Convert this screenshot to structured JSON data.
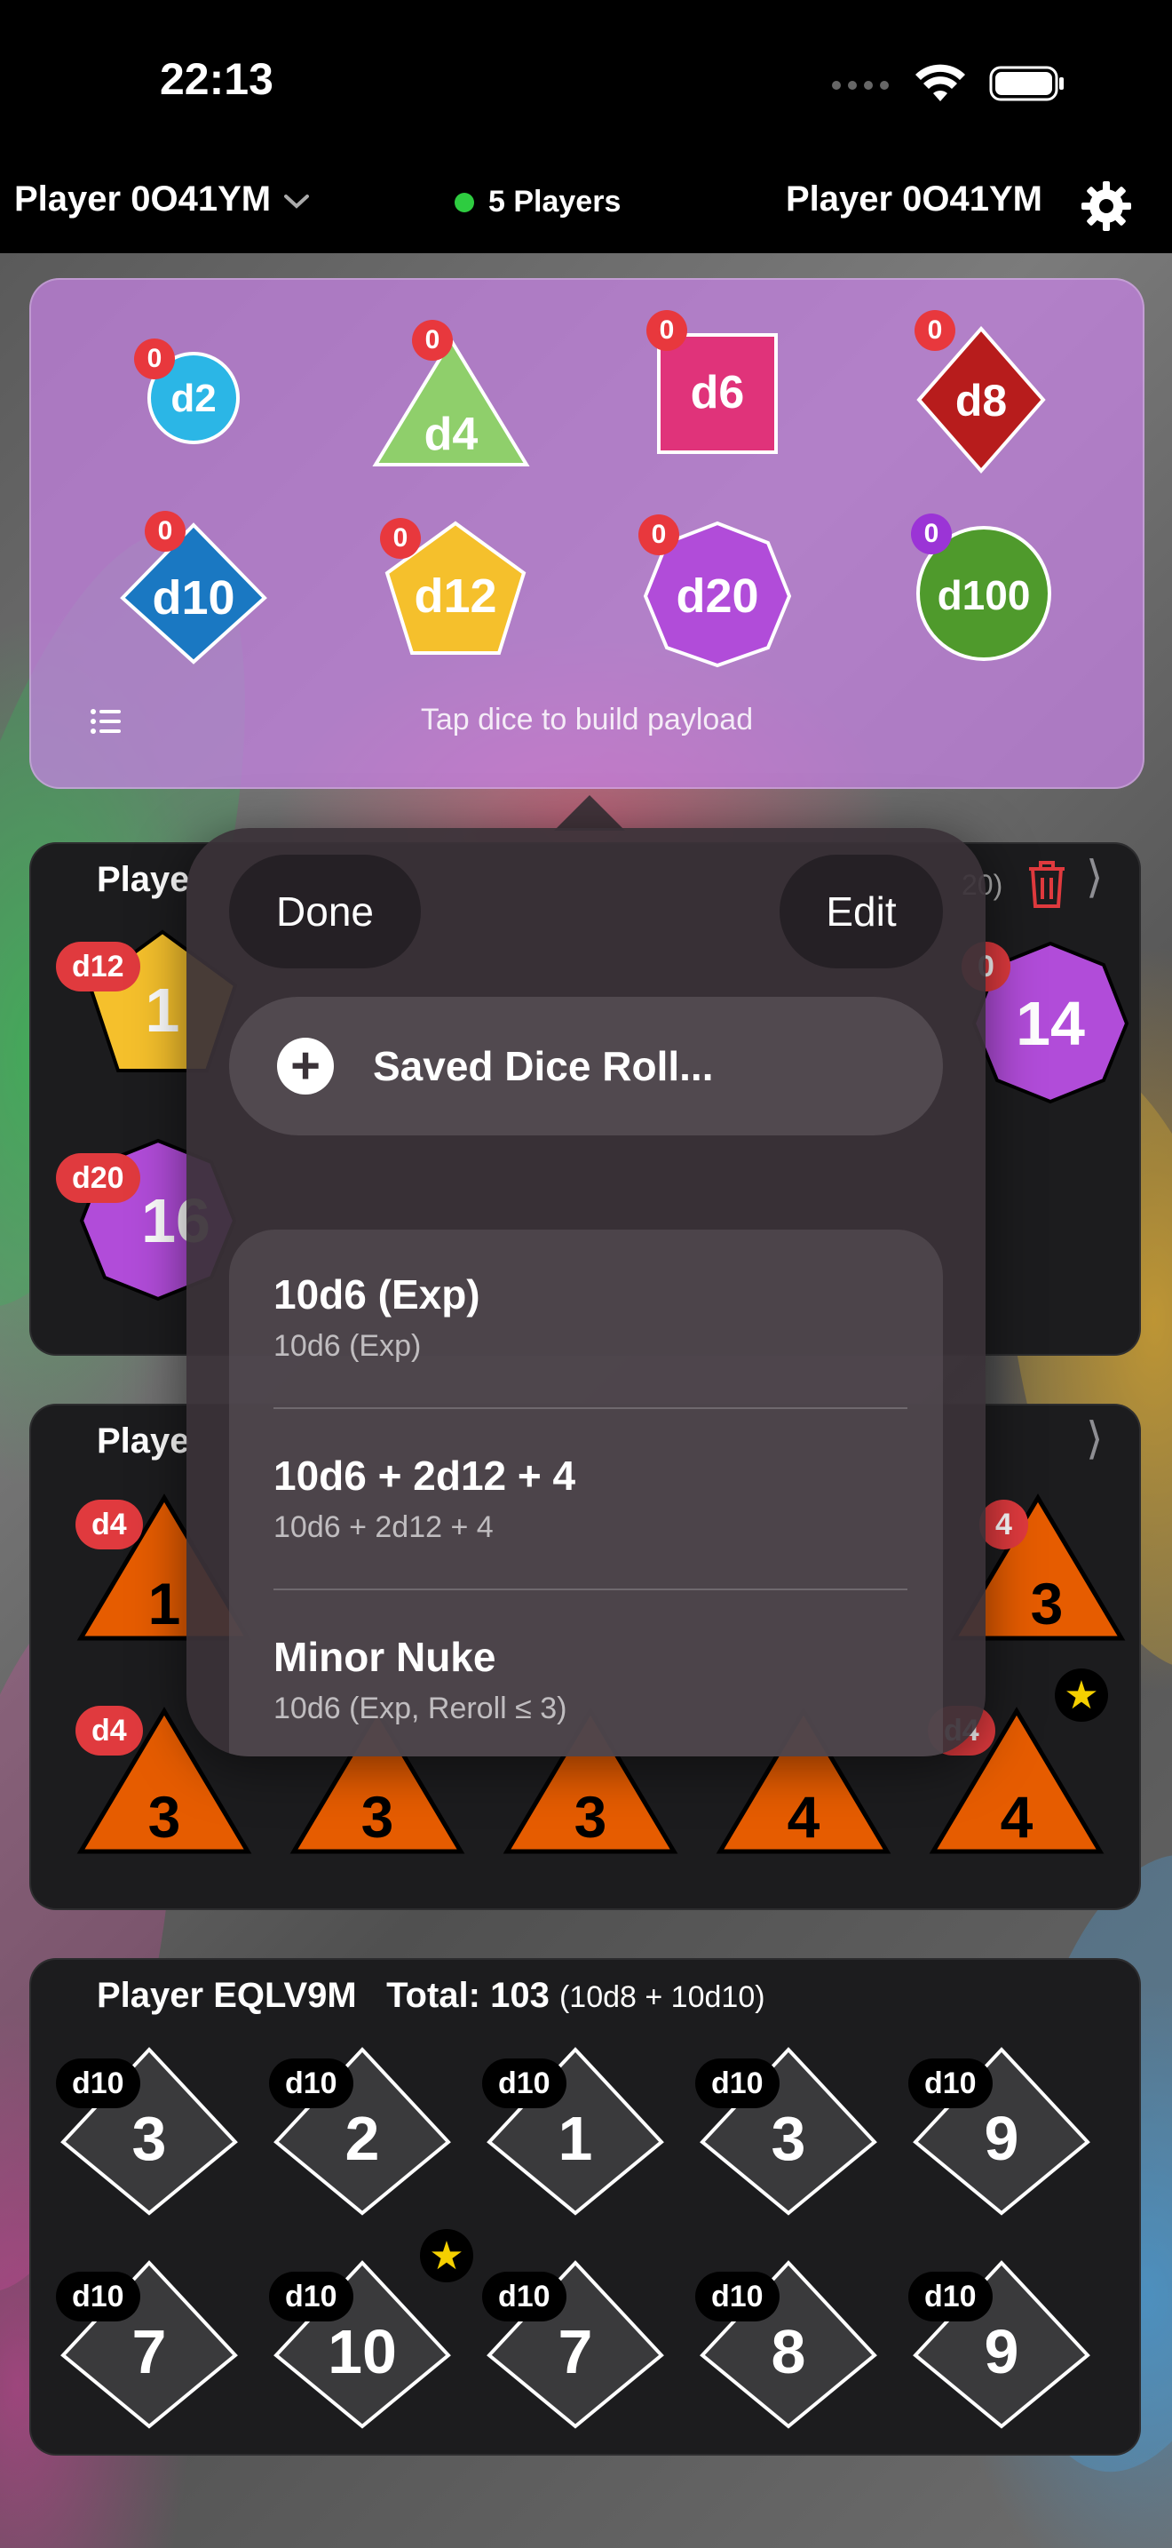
{
  "status": {
    "time": "22:13"
  },
  "nav": {
    "left_player": "Player 0O41YM",
    "players_count": "5 Players",
    "right_player": "Player 0O41YM"
  },
  "picker": {
    "dice": [
      {
        "name": "d2",
        "count": "0",
        "color": "#2bb6e6"
      },
      {
        "name": "d4",
        "count": "0",
        "color": "#8fcf6b"
      },
      {
        "name": "d6",
        "count": "0",
        "color": "#e0337a"
      },
      {
        "name": "d8",
        "count": "0",
        "color": "#b71c1c"
      },
      {
        "name": "d10",
        "count": "0",
        "color": "#1a78c2"
      },
      {
        "name": "d12",
        "count": "0",
        "color": "#f5c02c"
      },
      {
        "name": "d20",
        "count": "0",
        "color": "#b14cd9"
      },
      {
        "name": "d100",
        "count": "0",
        "color": "#4f9a2c"
      }
    ],
    "hint": "Tap dice to build payload"
  },
  "cards": [
    {
      "title": "Playe",
      "total_fragment": "20)",
      "dice": [
        {
          "type": "d12",
          "value": "1"
        },
        {
          "type": "d20",
          "value": "14"
        },
        {
          "type": "d20",
          "value": "16"
        }
      ],
      "partial_tag": "0"
    },
    {
      "title": "Playe",
      "row1": [
        {
          "type": "d4",
          "value": "1"
        },
        {
          "type": "4",
          "value": "3"
        }
      ],
      "row2": [
        {
          "type": "d4",
          "value": "3"
        },
        {
          "type": "d4",
          "value": "3"
        },
        {
          "type": "d4",
          "value": "3"
        },
        {
          "type": "d4",
          "value": "4"
        },
        {
          "type": "d4",
          "value": "4"
        }
      ]
    },
    {
      "player": "Player EQLV9M",
      "total_label": "Total:",
      "total": "103",
      "formula": "(10d8 + 10d10)",
      "row1": [
        {
          "type": "d10",
          "value": "3"
        },
        {
          "type": "d10",
          "value": "2"
        },
        {
          "type": "d10",
          "value": "1"
        },
        {
          "type": "d10",
          "value": "3"
        },
        {
          "type": "d10",
          "value": "9"
        }
      ],
      "row2": [
        {
          "type": "d10",
          "value": "7"
        },
        {
          "type": "d10",
          "value": "10"
        },
        {
          "type": "d10",
          "value": "7"
        },
        {
          "type": "d10",
          "value": "8"
        },
        {
          "type": "d10",
          "value": "9"
        }
      ]
    }
  ],
  "menu": {
    "done": "Done",
    "edit": "Edit",
    "saved": "Saved Dice Roll...",
    "items": [
      {
        "title": "10d6 (Exp)",
        "subtitle": "10d6 (Exp)"
      },
      {
        "title": "10d6 + 2d12 + 4",
        "subtitle": "10d6 + 2d12 + 4"
      },
      {
        "title": "Minor Nuke",
        "subtitle": "10d6 (Exp, Reroll ≤ 3)"
      }
    ]
  },
  "colors": {
    "d4_result": "#e65c00",
    "d10_result": "#3a3a3c",
    "badge": "#e8383d",
    "d100_badge": "#9b34d6"
  }
}
